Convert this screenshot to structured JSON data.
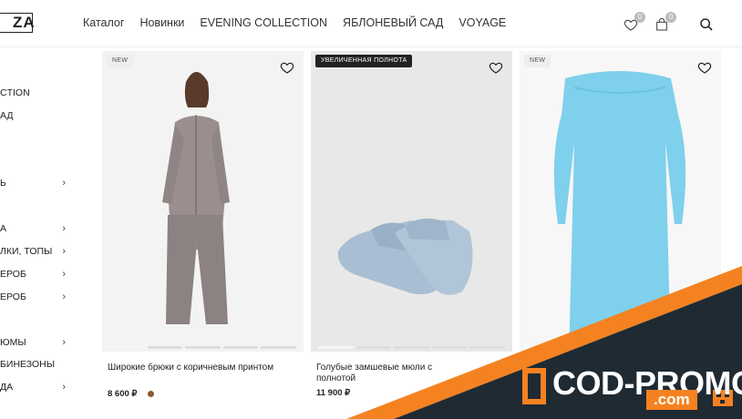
{
  "header": {
    "logo_text": "ZA",
    "nav": [
      "Каталог",
      "Новинки",
      "EVENING COLLECTION",
      "ЯБЛОНЕВЫЙ САД",
      "VOYAGE"
    ],
    "wishlist_count": "0",
    "cart_count": "0"
  },
  "sidebar": {
    "items": [
      {
        "label": "CTION",
        "chevron": ""
      },
      {
        "label": "АД",
        "chevron": ""
      },
      {
        "label": "Ь",
        "chevron": "›"
      },
      {
        "label": "А",
        "chevron": "›"
      },
      {
        "label": "ЛКИ, ТОПЫ",
        "chevron": "›"
      },
      {
        "label": "ЕРОБ",
        "chevron": "›"
      },
      {
        "label": "ЕРОБ",
        "chevron": "›"
      },
      {
        "label": "ЮМЫ",
        "chevron": "›"
      },
      {
        "label": "БИНЕЗОНЫ",
        "chevron": ""
      },
      {
        "label": "ДА",
        "chevron": "›"
      }
    ]
  },
  "products": [
    {
      "tag": "NEW",
      "name": "Широкие брюки с коричневым принтом",
      "price": "8 600 ₽",
      "swatch_color": "#8a5a2b",
      "image_bg": "#f3f3f3"
    },
    {
      "tag": "УВЕЛИЧЕННАЯ ПОЛНОТА",
      "name": "Голубые замшевые мюли с\nполнотой",
      "price": "11 900 ₽",
      "image_bg": "#e8e8e8"
    },
    {
      "tag": "NEW",
      "name": "",
      "price": "",
      "image_bg": "#f7f7f7"
    }
  ],
  "promo": {
    "text": "COD-PROMO",
    "sub": ".com",
    "accent": "#f58220",
    "dark": "#1f2a33"
  }
}
